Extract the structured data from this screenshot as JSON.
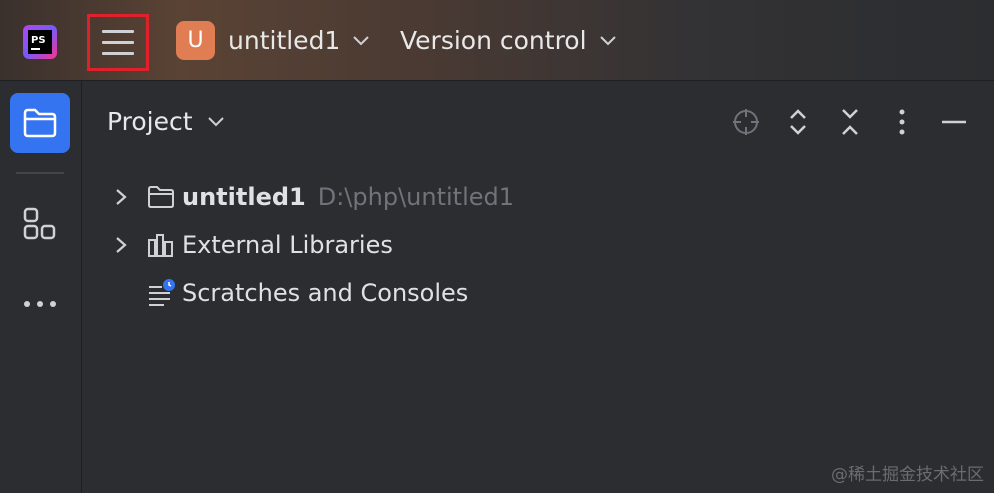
{
  "titlebar": {
    "app_icon": "phpstorm-logo-icon",
    "app_logo_text": "PS",
    "menu_icon": "hamburger-menu-icon",
    "project_badge": "U",
    "project_name": "untitled1",
    "vcs_label": "Version control"
  },
  "sidebar": {
    "items": [
      {
        "icon": "folder-icon",
        "active": true
      },
      {
        "icon": "structure-icon",
        "active": false
      },
      {
        "icon": "more-icon",
        "active": false
      }
    ]
  },
  "panel": {
    "title": "Project",
    "toolbar_icons": [
      "locate-icon",
      "expand-all-icon",
      "collapse-all-icon",
      "options-icon",
      "hide-icon"
    ]
  },
  "tree": [
    {
      "label": "untitled1",
      "path": "D:\\php\\untitled1",
      "icon": "folder-icon",
      "expandable": true,
      "bold": true
    },
    {
      "label": "External Libraries",
      "icon": "libraries-icon",
      "expandable": true
    },
    {
      "label": "Scratches and Consoles",
      "icon": "scratches-icon",
      "expandable": false
    }
  ],
  "watermark": "@稀土掘金技术社区",
  "colors": {
    "accent": "#3574f0",
    "badge": "#e07d52",
    "highlight": "#e0202a"
  }
}
